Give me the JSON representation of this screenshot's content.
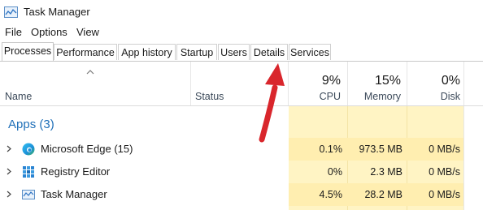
{
  "window": {
    "title": "Task Manager",
    "icon": "task-manager-icon"
  },
  "menu": [
    "File",
    "Options",
    "View"
  ],
  "tabs": [
    {
      "label": "Processes",
      "active": true
    },
    {
      "label": "Performance",
      "active": false
    },
    {
      "label": "App history",
      "active": false
    },
    {
      "label": "Startup",
      "active": false
    },
    {
      "label": "Users",
      "active": false
    },
    {
      "label": "Details",
      "active": false
    },
    {
      "label": "Services",
      "active": false
    }
  ],
  "columns": {
    "name": "Name",
    "status": "Status",
    "cpu": {
      "pct": "9%",
      "label": "CPU"
    },
    "memory": {
      "pct": "15%",
      "label": "Memory"
    },
    "disk": {
      "pct": "0%",
      "label": "Disk"
    }
  },
  "group": {
    "label": "Apps (3)"
  },
  "rows": [
    {
      "name": "Microsoft Edge (15)",
      "icon": "edge-icon",
      "cpu": "0.1%",
      "memory": "973.5 MB",
      "disk": "0 MB/s"
    },
    {
      "name": "Registry Editor",
      "icon": "registry-editor-icon",
      "cpu": "0%",
      "memory": "2.3 MB",
      "disk": "0 MB/s"
    },
    {
      "name": "Task Manager",
      "icon": "task-manager-icon",
      "cpu": "4.5%",
      "memory": "28.2 MB",
      "disk": "0 MB/s"
    }
  ],
  "colors": {
    "accent": "#1f6fb8",
    "heat": "#fff4c4",
    "heat_row": "#ffeeb0",
    "arrow": "#d9262c"
  },
  "annotation": {
    "icon": "red-arrow-icon",
    "points_to": "Details"
  }
}
